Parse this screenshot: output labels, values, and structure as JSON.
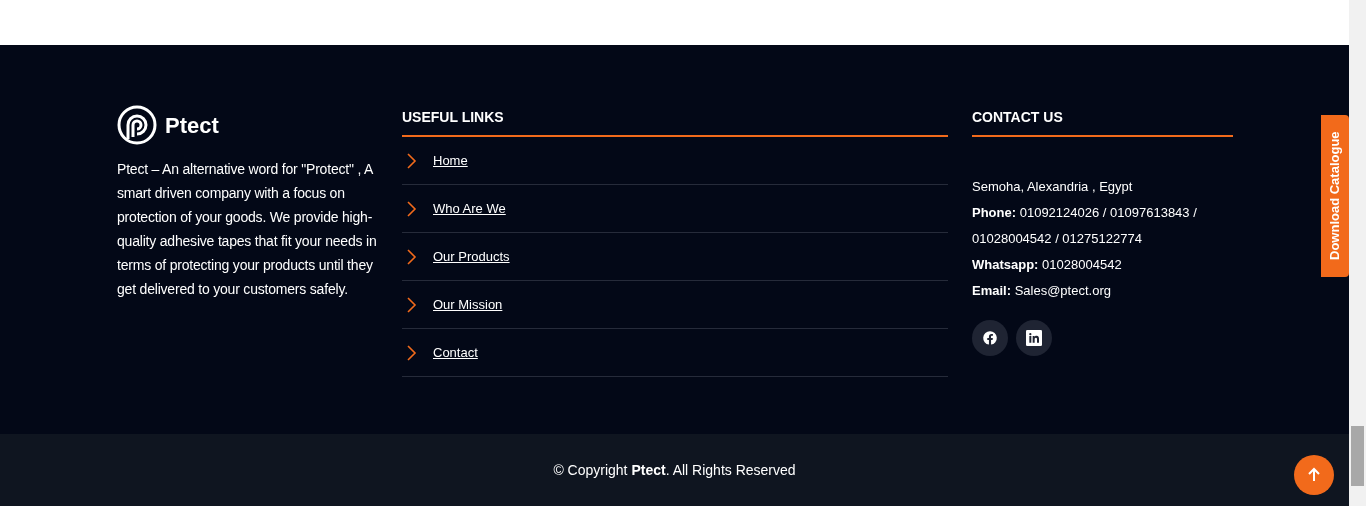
{
  "brand": {
    "name": "Ptect",
    "description": "Ptect – An alternative word for \"Protect\" , A smart driven company with a focus on protection of your goods. We provide high-quality adhesive tapes that fit your needs in terms of protecting your products until they get delivered to your customers safely."
  },
  "useful_links": {
    "title": "USEFUL LINKS",
    "links": [
      "Home",
      "Who Are We",
      "Our Products",
      "Our Mission",
      "Contact"
    ]
  },
  "contact": {
    "title": "CONTACT US",
    "address": "Semoha, Alexandria , Egypt",
    "lines": [
      {
        "label": "Phone:",
        "value": "01092124026 / 01097613843 / 01028004542 / 01275122774"
      },
      {
        "label": "Whatsapp:",
        "value": "01028004542"
      },
      {
        "label": "Email:",
        "value": "Sales@ptect.org"
      }
    ],
    "social": [
      {
        "kind": "facebook"
      },
      {
        "kind": "linkedin"
      }
    ]
  },
  "side_tab": "Download Catalogue",
  "copyright": "© Copyright **Ptect**. All Rights Reserved"
}
